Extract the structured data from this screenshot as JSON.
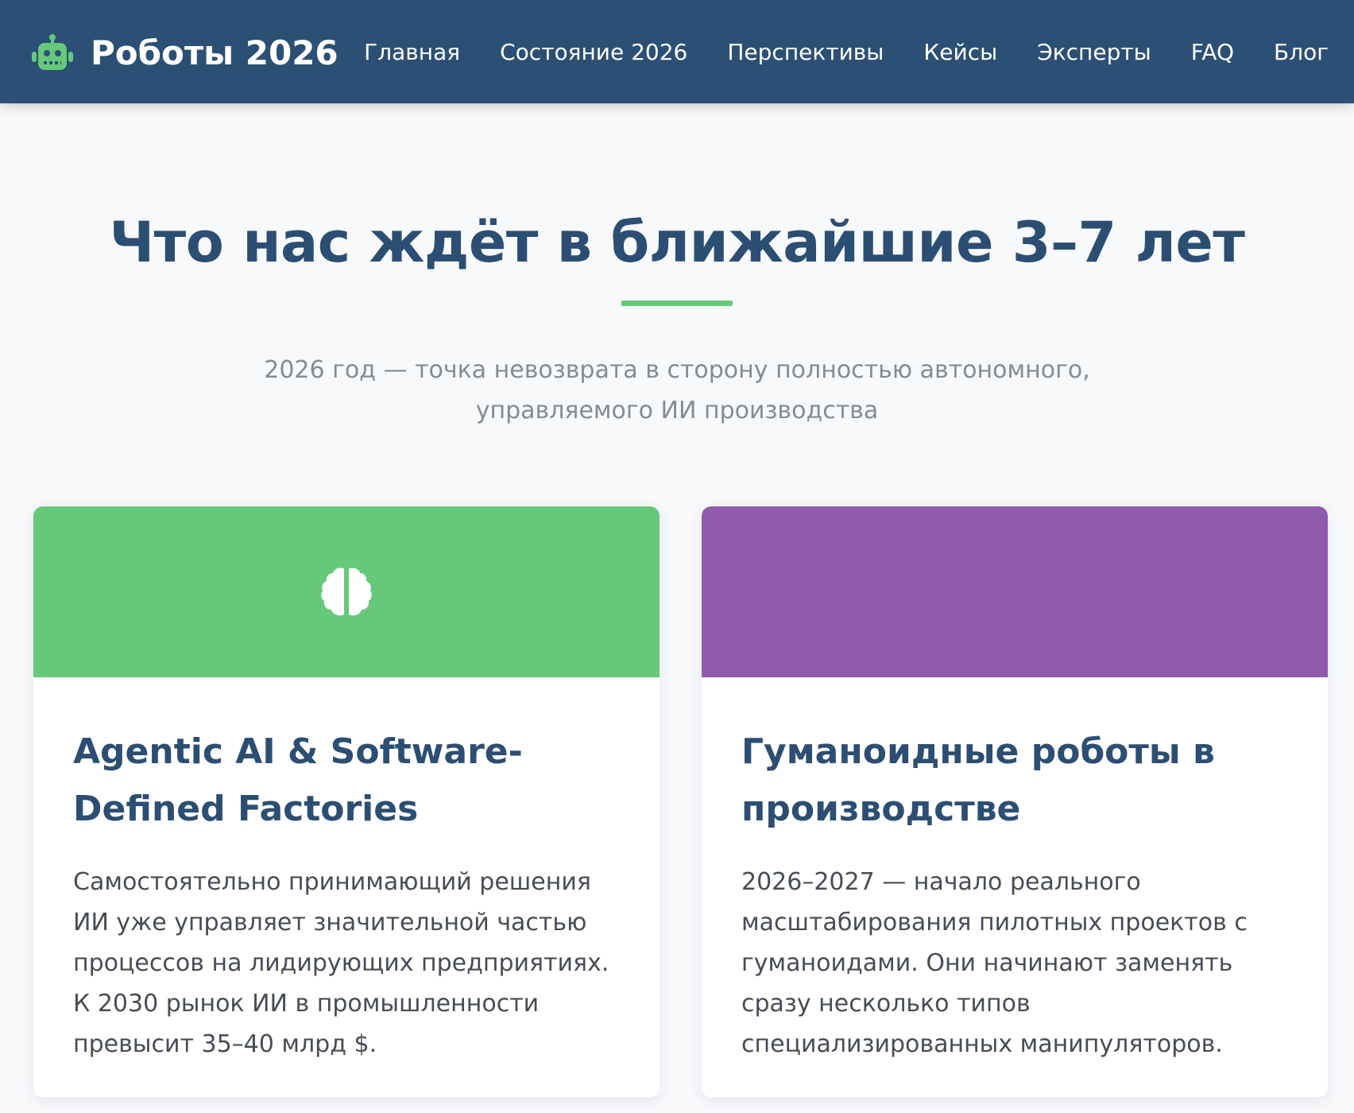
{
  "colors": {
    "header_bg": "#2c5075",
    "accent_green": "#66c97a",
    "accent_purple": "#915bad",
    "heading": "#2c4e73"
  },
  "header": {
    "logo_icon": "robot-icon",
    "logo_text": "Роботы 2026",
    "nav": [
      {
        "label": "Главная"
      },
      {
        "label": "Состояние 2026"
      },
      {
        "label": "Перспективы"
      },
      {
        "label": "Кейсы"
      },
      {
        "label": "Эксперты"
      },
      {
        "label": "FAQ"
      },
      {
        "label": "Блог"
      }
    ]
  },
  "hero": {
    "title": "Что нас ждёт в ближайшие 3–7 лет",
    "subtitle": "2026 год — точка невозврата в сторону полностью автономного, управляемого ИИ производства"
  },
  "cards": [
    {
      "icon": "brain-icon",
      "banner_color": "#66c97a",
      "title": "Agentic AI & Software-Defined Factories",
      "text": "Самостоятельно принимающий решения ИИ уже управляет значительной частью процессов на лидирующих предприятиях. К 2030 рынок ИИ в промышленности превысит 35–40 млрд $."
    },
    {
      "banner_color": "#915bad",
      "title": "Гуманоидные роботы в производстве",
      "text": "2026–2027 — начало реального масштабирования пилотных проектов с гуманоидами. Они начинают заменять сразу несколько типов специализированных манипуляторов."
    }
  ]
}
